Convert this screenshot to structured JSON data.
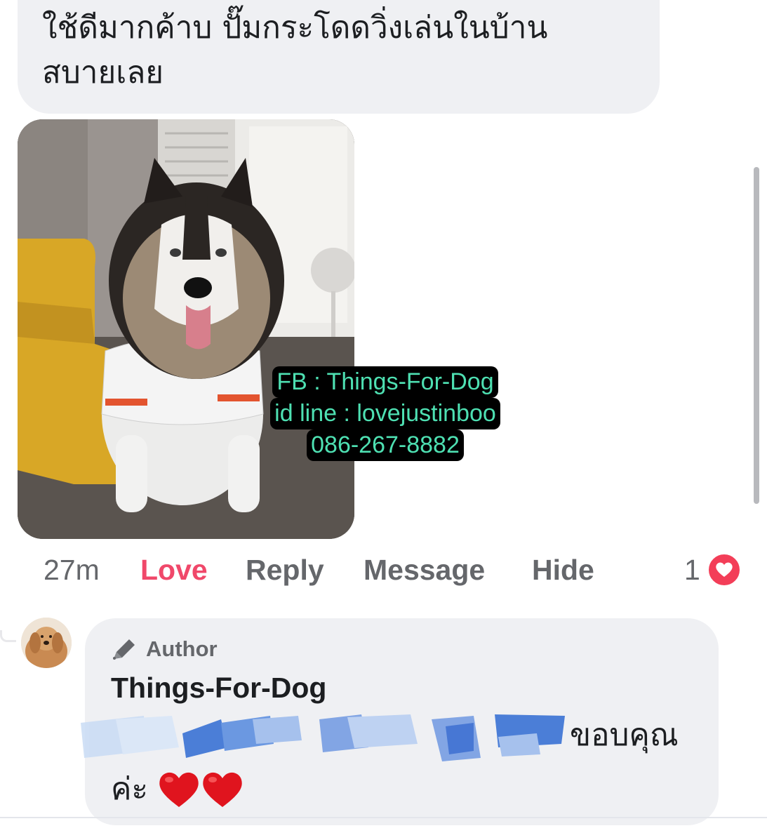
{
  "comment": {
    "text_line1": "ใช้ดีมากค้าบ ปั๊มกระโดดวิ่งเล่นในบ้าน",
    "text_line2": "สบายเลย",
    "photo_watermark": [
      "FB : Things-For-Dog",
      "id line : lovejustinboo",
      "086-267-8882"
    ],
    "actions": {
      "time": "27m",
      "love": "Love",
      "reply": "Reply",
      "message": "Message",
      "hide": "Hide"
    },
    "reaction_count": "1",
    "reaction_type": "heart",
    "reaction_color": "#f33e58",
    "love_color": "#f0486a"
  },
  "reply": {
    "author_badge": "Author",
    "author_badge_icon": "pencil-icon",
    "author_name": "Things-For-Dog",
    "text_line1_end": "ขอบคุณ",
    "text_line2": "ค่ะ",
    "emoji": [
      "heart-emoji",
      "heart-emoji"
    ]
  }
}
